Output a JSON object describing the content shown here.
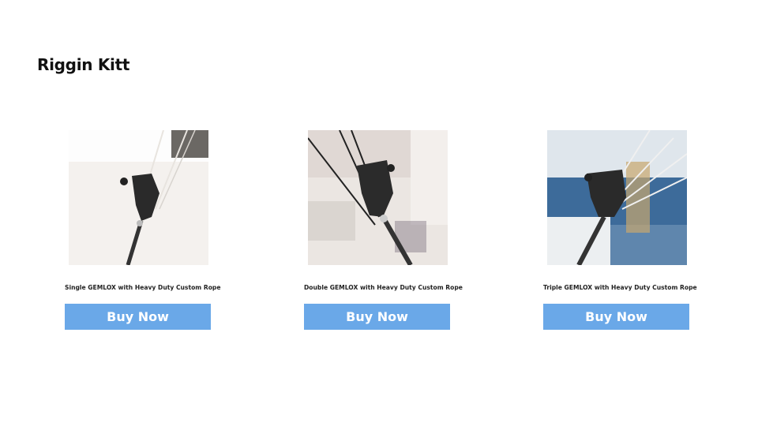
{
  "page": {
    "title": "Riggin Kitt"
  },
  "products": [
    {
      "title": "Single GEMLOX with Heavy Duty Custom Rope",
      "button_label": "Buy Now",
      "image_icon": "single-gemlox-product-photo"
    },
    {
      "title": "Double GEMLOX with Heavy Duty Custom Rope",
      "button_label": "Buy Now",
      "image_icon": "double-gemlox-product-photo"
    },
    {
      "title": "Triple GEMLOX with Heavy Duty Custom Rope",
      "button_label": "Buy Now",
      "image_icon": "triple-gemlox-product-photo"
    }
  ],
  "colors": {
    "button": "#6aa8e8",
    "button_text": "#ffffff",
    "title": "#111111"
  }
}
